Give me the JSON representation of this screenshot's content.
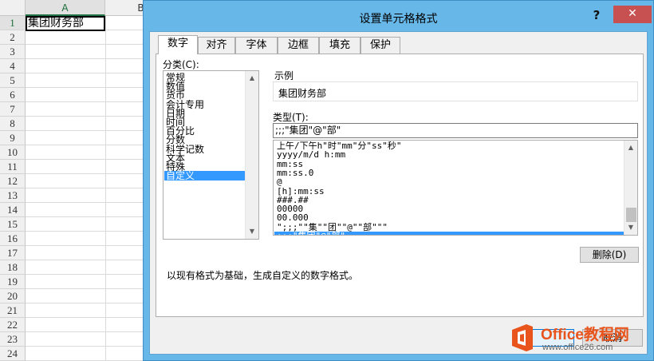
{
  "spreadsheet": {
    "columns": [
      "A",
      "B"
    ],
    "rows": [
      "1",
      "2",
      "3",
      "4",
      "5",
      "6",
      "7",
      "8",
      "9",
      "10",
      "11",
      "12",
      "13",
      "14",
      "15",
      "16",
      "17",
      "18",
      "19",
      "20",
      "21",
      "22",
      "23",
      "24"
    ],
    "cell_a1": "集团财务部"
  },
  "dialog": {
    "title": "设置单元格格式",
    "help": "?",
    "close": "✕",
    "tabs": [
      "数字",
      "对齐",
      "字体",
      "边框",
      "填充",
      "保护"
    ],
    "active_tab": "数字",
    "category_label": "分类(C):",
    "categories": [
      "常规",
      "数值",
      "货币",
      "会计专用",
      "日期",
      "时间",
      "百分比",
      "分数",
      "科学记数",
      "文本",
      "特殊",
      "自定义"
    ],
    "selected_category": "自定义",
    "sample_label": "示例",
    "sample_value": "集团财务部",
    "type_label": "类型(T):",
    "type_value": ";;;\"集团\"@\"部\"",
    "format_list": [
      "上午/下午h\"时\"mm\"分\"ss\"秒\"",
      "yyyy/m/d h:mm",
      "mm:ss",
      "mm:ss.0",
      "@",
      "[h]:mm:ss",
      "###.##",
      "00000",
      "00.000",
      "\";;;\"\"集\"\"团\"\"@\"\"部\"\"\"",
      ";;;\"集团\"@\"部\""
    ],
    "selected_format": ";;;\"集团\"@\"部\"",
    "delete_button": "删除(D)",
    "description": "以现有格式为基础，生成自定义的数字格式。",
    "cancel_button": "取消"
  },
  "watermark": {
    "brand": "Office教程网",
    "url": "www.office26.com"
  },
  "colors": {
    "dialog_frame": "#67b7e8",
    "close_button": "#c75050",
    "selection": "#3399ff",
    "watermark_orange": "#e8541b"
  }
}
